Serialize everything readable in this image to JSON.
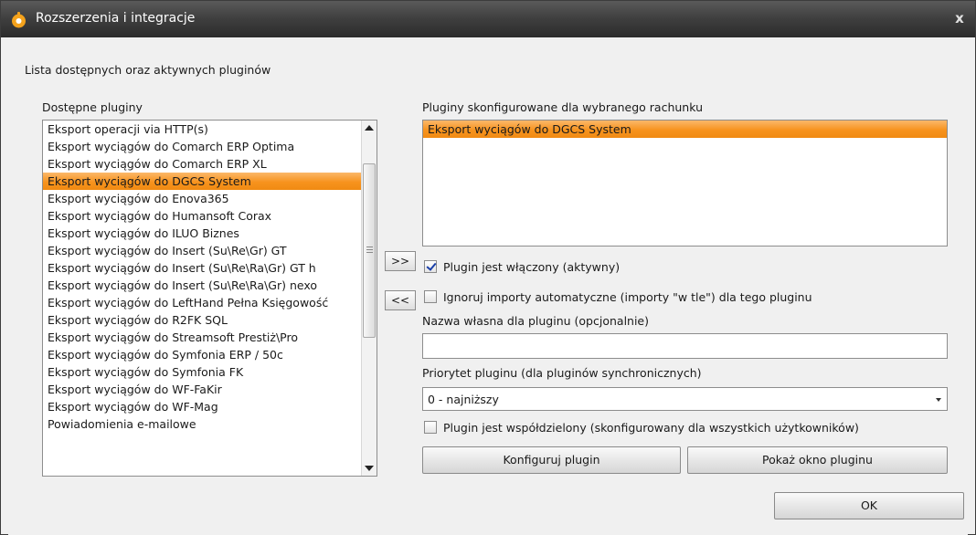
{
  "window": {
    "title": "Rozszerzenia i integracje",
    "close_label": "x"
  },
  "header_text": "Lista dostępnych oraz aktywnych pluginów",
  "available": {
    "label": "Dostępne pluginy",
    "items": [
      "Eksport operacji via HTTP(s)",
      "Eksport wyciągów do Comarch ERP Optima",
      "Eksport wyciągów do Comarch ERP XL",
      "Eksport wyciągów do DGCS System",
      "Eksport wyciągów do Enova365",
      "Eksport wyciągów do Humansoft Corax",
      "Eksport wyciągów do ILUO Biznes",
      "Eksport wyciągów do Insert (Su\\Re\\Gr) GT",
      "Eksport wyciągów do Insert (Su\\Re\\Ra\\Gr) GT h",
      "Eksport wyciągów do Insert (Su\\Re\\Ra\\Gr) nexo",
      "Eksport wyciągów do LeftHand Pełna Księgowość",
      "Eksport wyciągów do R2FK SQL",
      "Eksport wyciągów do Streamsoft Prestiż\\Pro",
      "Eksport wyciągów do Symfonia ERP / 50c",
      "Eksport wyciągów do Symfonia FK",
      "Eksport wyciągów do WF-FaKir",
      "Eksport wyciągów do WF-Mag",
      "Powiadomienia e-mailowe"
    ],
    "selected_index": 3
  },
  "buttons": {
    "add": ">>",
    "remove": "<<",
    "configure": "Konfiguruj plugin",
    "show_window": "Pokaż okno pluginu",
    "ok": "OK"
  },
  "configured": {
    "label": "Pluginy skonfigurowane dla wybranego rachunku",
    "items": [
      "Eksport wyciągów do DGCS System"
    ],
    "selected_index": 0
  },
  "options": {
    "enabled_label": "Plugin jest włączony (aktywny)",
    "enabled_checked": true,
    "ignore_label": "Ignoruj importy automatyczne (importy \"w tle\") dla tego pluginu",
    "ignore_checked": false,
    "name_label": "Nazwa własna dla pluginu (opcjonalnie)",
    "name_value": "",
    "priority_label": "Priorytet pluginu (dla pluginów synchronicznych)",
    "priority_value": "0 - najniższy",
    "shared_label": "Plugin jest współdzielony (skonfigurowany dla wszystkich użytkowników)",
    "shared_checked": false
  },
  "colors": {
    "selection": "#f7931e",
    "titlebar": "#3e3e3e"
  }
}
